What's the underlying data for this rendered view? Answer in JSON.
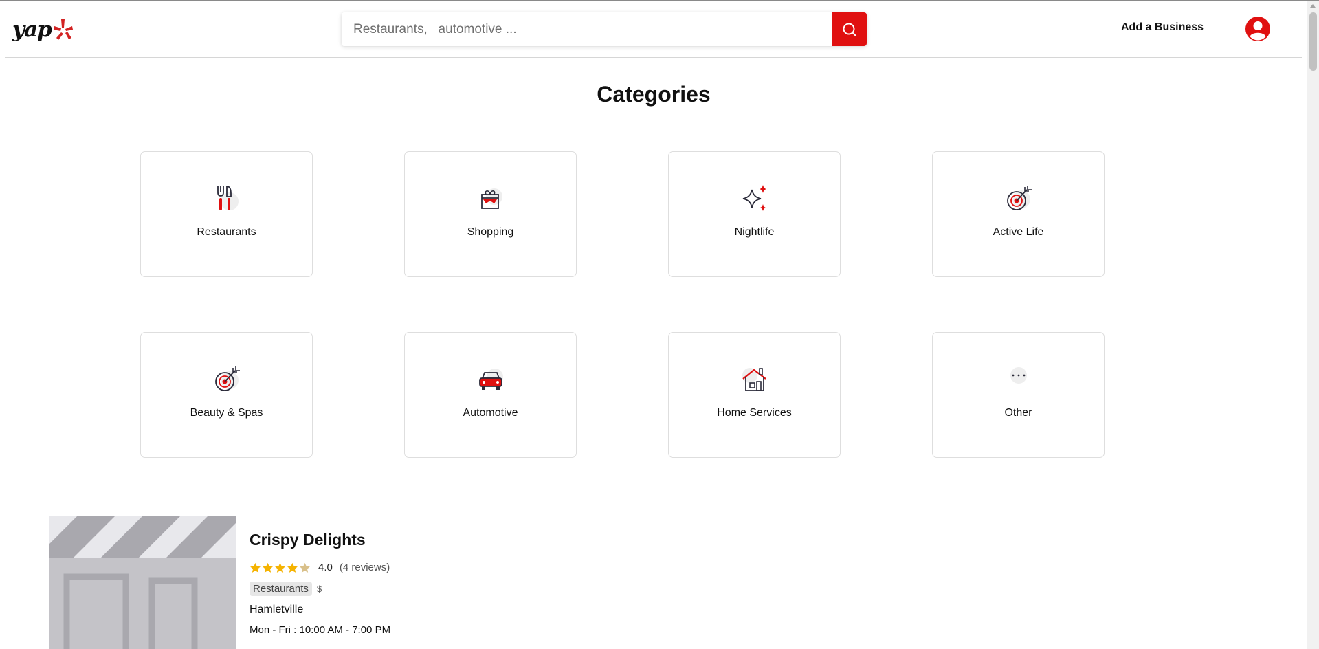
{
  "header": {
    "logo_text": "yap",
    "search_placeholder": "Restaurants,   automotive ...",
    "add_business_label": "Add a Business"
  },
  "page_title": "Categories",
  "categories": [
    {
      "label": "Restaurants",
      "icon": "utensils-icon"
    },
    {
      "label": "Shopping",
      "icon": "gift-icon"
    },
    {
      "label": "Nightlife",
      "icon": "sparkles-icon"
    },
    {
      "label": "Active Life",
      "icon": "target-icon"
    },
    {
      "label": "Beauty & Spas",
      "icon": "target-icon"
    },
    {
      "label": "Automotive",
      "icon": "car-icon"
    },
    {
      "label": "Home Services",
      "icon": "house-icon"
    },
    {
      "label": "Other",
      "icon": "ellipsis-icon"
    }
  ],
  "business": {
    "name": "Crispy Delights",
    "rating": "4.0",
    "rating_value": 4.0,
    "rating_max": 5,
    "reviews": "(4 reviews)",
    "category_tag": "Restaurants",
    "price": "$",
    "location": "Hamletville",
    "hours": "Mon - Fri : 10:00 AM - 7:00 PM"
  },
  "colors": {
    "brand_red": "#e01010",
    "star": "#f5b301",
    "icon_dark": "#2b2b3a"
  }
}
